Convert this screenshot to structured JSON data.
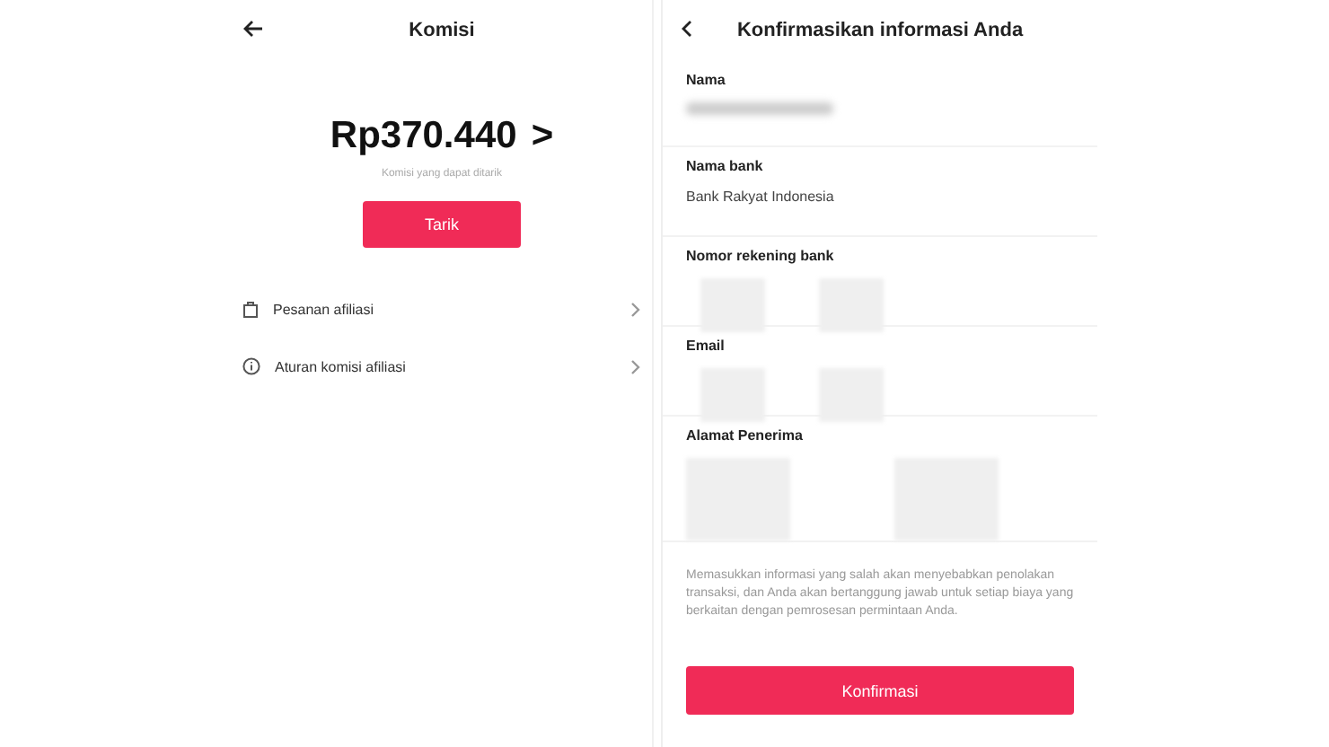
{
  "commission_screen": {
    "title": "Komisi",
    "amount": "Rp370.440",
    "amount_arrow": ">",
    "subtitle": "Komisi yang dapat ditarik",
    "withdraw_button": "Tarik",
    "menu": [
      {
        "kind": "bag",
        "label": "Pesanan afiliasi"
      },
      {
        "kind": "info",
        "label": "Aturan komisi afiliasi"
      }
    ]
  },
  "confirm_screen": {
    "title": "Konfirmasikan informasi Anda",
    "fields": [
      {
        "label": "Nama",
        "kind": "blurred"
      },
      {
        "label": "Nama bank",
        "kind": "text",
        "value": "Bank Rakyat Indonesia"
      },
      {
        "label": "Nomor rekening bank",
        "kind": "redacted"
      },
      {
        "label": "Email",
        "kind": "redacted"
      },
      {
        "label": "Alamat Penerima",
        "kind": "redacted_large"
      }
    ],
    "notice": "Memasukkan informasi yang salah akan menyebabkan penolakan transaksi, dan Anda akan bertanggung jawab untuk setiap biaya yang berkaitan dengan pemrosesan permintaan Anda.",
    "confirm_button": "Konfirmasi"
  }
}
